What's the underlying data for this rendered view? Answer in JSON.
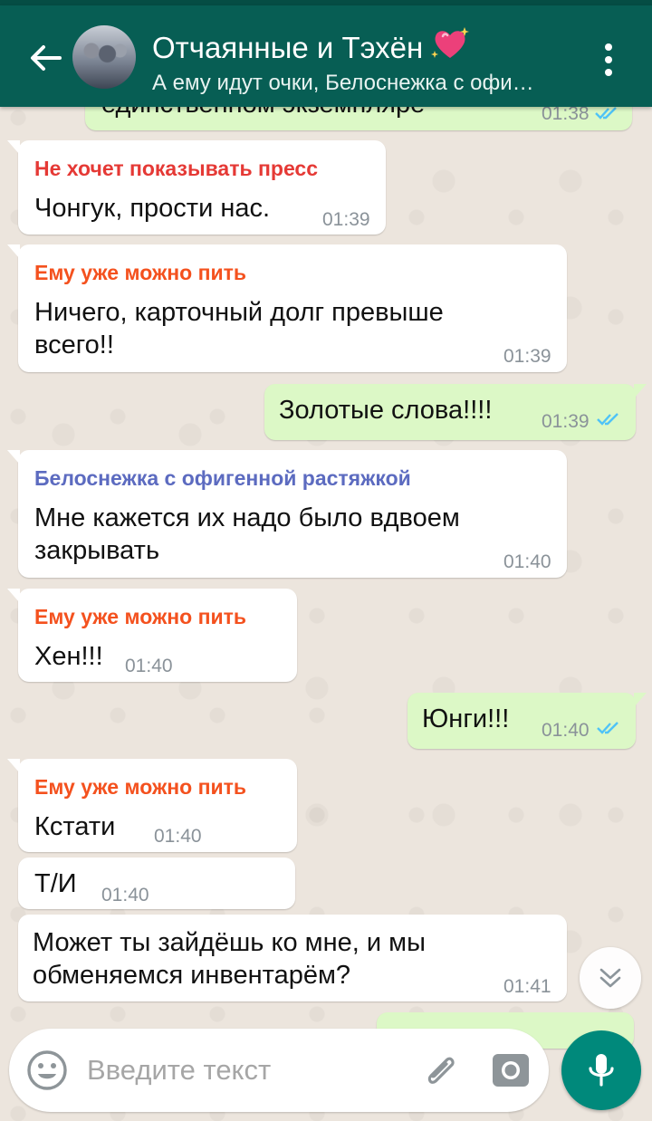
{
  "header": {
    "title": "Отчаянные и Тэхён",
    "subtitle": "А ему идут очки, Белоснежка с офи…",
    "heart_icon": "sparkling-heart-icon",
    "back_icon": "arrow-back-icon",
    "menu_icon": "more-vertical-icon"
  },
  "colors": {
    "header": "#075e54",
    "outgoing_bubble": "#dcf8c6",
    "incoming_bubble": "#ffffff",
    "read_ticks": "#4fc3f7",
    "mic_button": "#00897b"
  },
  "messages": [
    {
      "direction": "out",
      "text": "единственном экземпляре",
      "time": "01:38",
      "status": "read"
    },
    {
      "direction": "in",
      "sender": "Не хочет показывать пресс",
      "sender_color": "#e53935",
      "text": "Чонгук, прости нас.",
      "time": "01:39"
    },
    {
      "direction": "in",
      "sender": "Ему уже можно пить",
      "sender_color": "#f4511e",
      "text_lines": [
        "Ничего, карточный долг превыше",
        "всего!!"
      ],
      "time": "01:39"
    },
    {
      "direction": "out",
      "text": "Золотые слова!!!!",
      "time": "01:39",
      "status": "read"
    },
    {
      "direction": "in",
      "sender": "Белоснежка с офигенной растяжкой",
      "sender_color": "#5c6bc0",
      "text_lines": [
        "Мне кажется их надо было вдвоем",
        "закрывать"
      ],
      "time": "01:40"
    },
    {
      "direction": "in",
      "sender": "Ему уже можно пить",
      "sender_color": "#f4511e",
      "text": "Хен!!!",
      "time": "01:40"
    },
    {
      "direction": "out",
      "text": "Юнги!!!",
      "time": "01:40",
      "status": "read"
    },
    {
      "direction": "in",
      "sender": "Ему уже можно пить",
      "sender_color": "#f4511e",
      "text": "Кстати",
      "time": "01:40"
    },
    {
      "direction": "in",
      "text": "Т/И",
      "time": "01:40"
    },
    {
      "direction": "in",
      "text_lines": [
        "Может ты зайдёшь ко мне, и мы",
        "обменяемся инвентарём?"
      ],
      "time": "01:41"
    }
  ],
  "composer": {
    "placeholder": "Введите текст",
    "emoji_icon": "emoji-icon",
    "attach_icon": "paperclip-icon",
    "camera_icon": "camera-icon",
    "mic_icon": "microphone-icon",
    "scroll_icon": "chevron-double-down-icon"
  }
}
